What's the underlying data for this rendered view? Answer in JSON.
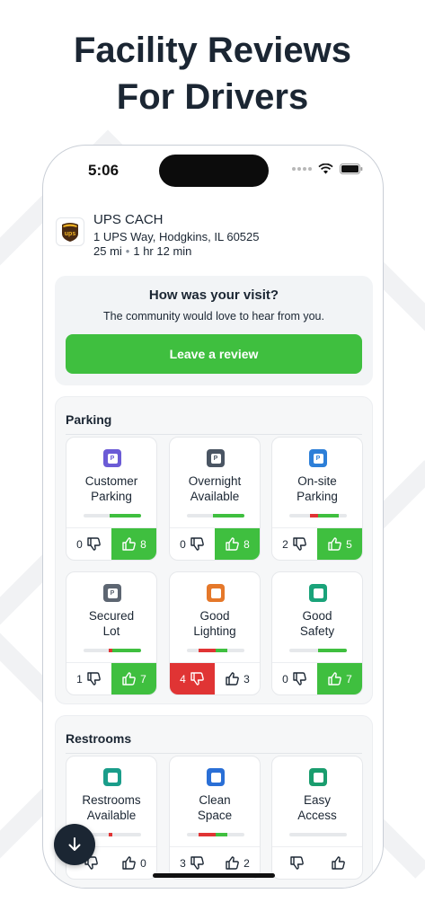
{
  "headline": {
    "line1": "Facility Reviews",
    "line2": "For Drivers"
  },
  "status_bar": {
    "time": "5:06"
  },
  "facility": {
    "name": "UPS CACH",
    "address": "1 UPS Way, Hodgkins, IL 60525",
    "distance": "25 mi",
    "drive_time": "1 hr 12 min",
    "logo_text": "ups"
  },
  "visit_prompt": {
    "title": "How was your visit?",
    "subtitle": "The community would love to hear from you.",
    "button_label": "Leave a review"
  },
  "colors": {
    "positive": "#3fbf3f",
    "negative": "#e03434",
    "dark": "#1b2633"
  },
  "sections": [
    {
      "title": "Parking",
      "cards": [
        {
          "line1": "Customer",
          "line2": "Parking",
          "icon": "parking-icon",
          "icon_letter": "P",
          "icon_color": "#6b5bd6",
          "down": "0",
          "up": "8",
          "active": "up",
          "neg_fraction": 0.0,
          "pos_fraction": 0.55
        },
        {
          "line1": "Overnight",
          "line2": "Available",
          "icon": "overnight-parking-icon",
          "icon_letter": "P",
          "icon_color": "#4a5563",
          "down": "0",
          "up": "8",
          "active": "up",
          "neg_fraction": 0.0,
          "pos_fraction": 0.55
        },
        {
          "line1": "On-site",
          "line2": "Parking",
          "icon": "onsite-parking-icon",
          "icon_letter": "P",
          "icon_color": "#2d7fd8",
          "down": "2",
          "up": "5",
          "active": "up",
          "neg_fraction": 0.14,
          "pos_fraction": 0.36
        },
        {
          "line1": "Secured",
          "line2": "Lot",
          "icon": "secured-lot-icon",
          "icon_letter": "P",
          "icon_color": "#5d6672",
          "down": "1",
          "up": "7",
          "active": "up",
          "neg_fraction": 0.06,
          "pos_fraction": 0.5
        },
        {
          "line1": "Good",
          "line2": "Lighting",
          "icon": "lighting-icon",
          "icon_letter": "",
          "icon_color": "#e5782a",
          "down": "4",
          "up": "3",
          "active": "down",
          "neg_fraction": 0.29,
          "pos_fraction": 0.21
        },
        {
          "line1": "Good",
          "line2": "Safety",
          "icon": "safety-shield-icon",
          "icon_letter": "",
          "icon_color": "#1aa37a",
          "down": "0",
          "up": "7",
          "active": "up",
          "neg_fraction": 0.0,
          "pos_fraction": 0.5
        }
      ]
    },
    {
      "title": "Restrooms",
      "cards": [
        {
          "line1": "Restrooms",
          "line2": "Available",
          "icon": "restroom-icon",
          "icon_letter": "",
          "icon_color": "#1a9d8a",
          "down": "",
          "up": "0",
          "active": "",
          "neg_fraction": 0.07,
          "pos_fraction": 0.0
        },
        {
          "line1": "Clean",
          "line2": "Space",
          "icon": "sparkle-icon",
          "icon_letter": "",
          "icon_color": "#2a6fd6",
          "down": "3",
          "up": "2",
          "active": "",
          "neg_fraction": 0.3,
          "pos_fraction": 0.2
        },
        {
          "line1": "Easy",
          "line2": "Access",
          "icon": "door-icon",
          "icon_letter": "",
          "icon_color": "#1a9d6e",
          "down": "",
          "up": "",
          "active": "",
          "neg_fraction": 0.0,
          "pos_fraction": 0.0
        }
      ]
    }
  ]
}
